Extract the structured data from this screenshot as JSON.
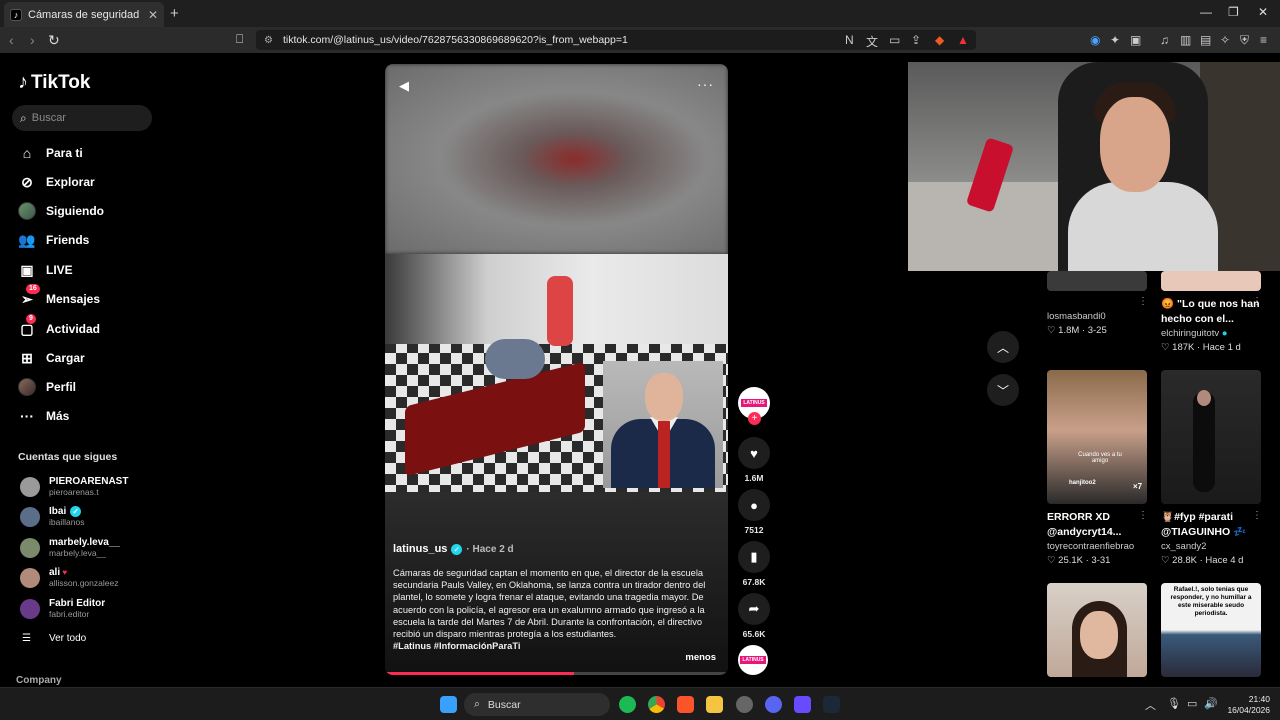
{
  "browser": {
    "tab_title": "Cámaras de seguridad captan el",
    "url": "tiktok.com/@latinus_us/video/7628756330869689620?is_from_webapp=1"
  },
  "sidebar": {
    "logo": "TikTok",
    "search_placeholder": "Buscar",
    "nav": [
      {
        "label": "Para ti",
        "icon": "home-icon"
      },
      {
        "label": "Explorar",
        "icon": "compass-icon"
      },
      {
        "label": "Siguiendo",
        "icon": "avatar"
      },
      {
        "label": "Friends",
        "icon": "friends-icon"
      },
      {
        "label": "LIVE",
        "icon": "live-icon"
      },
      {
        "label": "Mensajes",
        "icon": "message-icon",
        "badge": "16"
      },
      {
        "label": "Actividad",
        "icon": "activity-icon",
        "badge": "9"
      },
      {
        "label": "Cargar",
        "icon": "upload-icon"
      },
      {
        "label": "Perfil",
        "icon": "avatar"
      },
      {
        "label": "Más",
        "icon": "more-icon"
      }
    ],
    "following_heading": "Cuentas que sigues",
    "following": [
      {
        "name": "PIEROARENAST",
        "handle": "pieroarenas.t",
        "color": "#9a9a9a"
      },
      {
        "name": "Ibai",
        "handle": "ibaillanos",
        "verified": true,
        "color": "#5a6e8a"
      },
      {
        "name": "marbely.leva__",
        "handle": "marbely.leva__",
        "color": "#7a8a6a"
      },
      {
        "name": "ali",
        "handle": "allisson.gonzaleez",
        "color": "#b08a7a"
      },
      {
        "name": "Fabri Editor",
        "handle": "fabri.editor",
        "color": "#6a3a8a"
      }
    ],
    "see_all": "Ver todo",
    "company": "Company"
  },
  "video": {
    "author": "latinus_us",
    "posted": "· Hace 2 d",
    "description": "Cámaras de seguridad captan el momento en que, el director de la escuela secundaria Pauls Valley, en Oklahoma, se lanza contra un tirador dentro del plantel, lo somete y logra frenar el ataque, evitando una tragedia mayor. De acuerdo con la policía, el agresor era un exalumno armado que ingresó a la escuela la tarde del Martes 7 de Abril. Durante la confrontación, el directivo recibió un disparo mientras protegía a los estudiantes.",
    "hashtags": "#Latinus #InformaciónParaTi",
    "less_label": "menos",
    "progress": 0.55,
    "brand_badge": "LATINUS"
  },
  "actions": {
    "likes": "1.6M",
    "comments": "7512",
    "saves": "67.8K",
    "shares": "65.6K"
  },
  "grid": [
    {
      "title": "",
      "user": "losmasbandi0",
      "stats": "♡ 1.8M · 3-25"
    },
    {
      "title": "😡 \"Lo que nos han hecho con el...",
      "user": "elchiringuitotv",
      "stats": "♡ 187K · Hace 1 d"
    },
    {
      "title": "ERRORR XD @andycryt14...",
      "user": "toyrecontraenfiebrao",
      "stats": "♡ 25.1K · 3-31",
      "overlay_text": "Cuando ves a tu amigo",
      "tag": "hanjitoo2",
      "mult": "×7"
    },
    {
      "title": "🦉#fyp #parati @TIAGUINHO 💤",
      "user": "cx_sandy2",
      "stats": "♡ 28.8K · Hace 4 d"
    },
    {
      "overlay_text": "Rafael.!, solo tenias que responder, y no humillar a este miserable seudo periodista."
    }
  ],
  "taskbar": {
    "search": "Buscar",
    "time": "21:40",
    "date": "16/04/2026"
  }
}
